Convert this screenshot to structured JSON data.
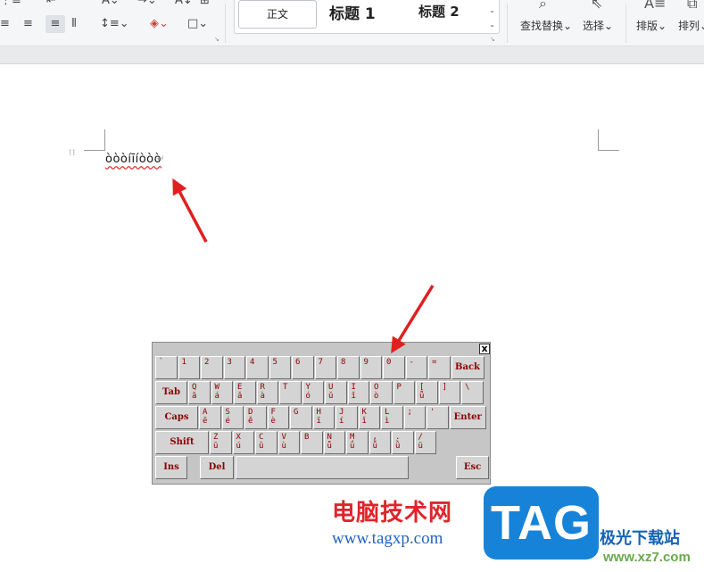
{
  "ribbon": {
    "styles": {
      "normal": "正文",
      "heading1": "标题 1",
      "heading2": "标题 2"
    },
    "find_replace_label": "查找替换",
    "select_label": "选择",
    "layout_label": "排版",
    "arrange_label": "排列"
  },
  "document": {
    "text": "òòòíīíòòò",
    "paragraph_mark": "↵"
  },
  "keyboard": {
    "close_label": "x",
    "row1": [
      {
        "a": "`",
        "b": ""
      },
      {
        "a": "1",
        "b": ""
      },
      {
        "a": "2",
        "b": ""
      },
      {
        "a": "3",
        "b": ""
      },
      {
        "a": "4",
        "b": ""
      },
      {
        "a": "5",
        "b": ""
      },
      {
        "a": "6",
        "b": ""
      },
      {
        "a": "7",
        "b": ""
      },
      {
        "a": "8",
        "b": ""
      },
      {
        "a": "9",
        "b": ""
      },
      {
        "a": "0",
        "b": ""
      },
      {
        "a": "-",
        "b": ""
      },
      {
        "a": "=",
        "b": ""
      }
    ],
    "back_label": "Back",
    "tab_label": "Tab",
    "row2": [
      {
        "a": "Q",
        "b": "ā"
      },
      {
        "a": "W",
        "b": "á"
      },
      {
        "a": "E",
        "b": "ǎ"
      },
      {
        "a": "R",
        "b": "à"
      },
      {
        "a": "T",
        "b": ""
      },
      {
        "a": "Y",
        "b": "ó"
      },
      {
        "a": "U",
        "b": "ǔ"
      },
      {
        "a": "I",
        "b": "ǐ"
      },
      {
        "a": "O",
        "b": "ò"
      },
      {
        "a": "P",
        "b": ""
      },
      {
        "a": "[",
        "b": "ǖ"
      },
      {
        "a": "]",
        "b": ""
      },
      {
        "a": "\\",
        "b": ""
      }
    ],
    "caps_label": "Caps",
    "row3": [
      {
        "a": "A",
        "b": "ē"
      },
      {
        "a": "S",
        "b": "é"
      },
      {
        "a": "D",
        "b": "ě"
      },
      {
        "a": "F",
        "b": "è"
      },
      {
        "a": "G",
        "b": ""
      },
      {
        "a": "H",
        "b": "ī"
      },
      {
        "a": "J",
        "b": "í"
      },
      {
        "a": "K",
        "b": "ǐ"
      },
      {
        "a": "L",
        "b": "ì"
      },
      {
        "a": ";",
        "b": ""
      },
      {
        "a": "'",
        "b": ""
      }
    ],
    "enter_label": "Enter",
    "shift_label": "Shift",
    "row4": [
      {
        "a": "Z",
        "b": "ū"
      },
      {
        "a": "X",
        "b": "ú"
      },
      {
        "a": "C",
        "b": "ǔ"
      },
      {
        "a": "V",
        "b": "ù"
      },
      {
        "a": "B",
        "b": ""
      },
      {
        "a": "N",
        "b": "ǖ"
      },
      {
        "a": "M",
        "b": "ǘ"
      },
      {
        "a": ",",
        "b": "ǚ"
      },
      {
        "a": ".",
        "b": "ǜ"
      },
      {
        "a": "/",
        "b": "ü"
      }
    ],
    "ins_label": "Ins",
    "del_label": "Del",
    "esc_label": "Esc"
  },
  "watermark": {
    "chinese": "电脑技术网",
    "url": "www.tagxp.com",
    "logo": "TAG",
    "site": "极光下载站",
    "domain": "www.xz7.com"
  },
  "colors": {
    "arrow": "#e02020",
    "key_text": "#8b0000",
    "keyboard_bg": "#c6c6c6"
  }
}
